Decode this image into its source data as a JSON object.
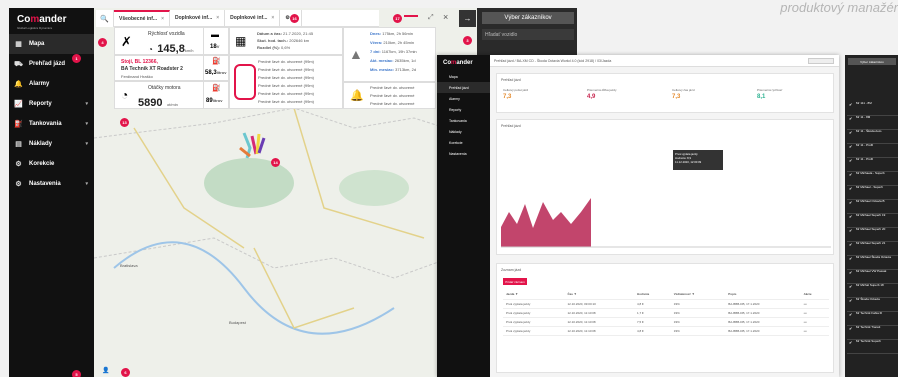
{
  "heading": "produktový manažér",
  "sidebar": {
    "logo_a": "Co",
    "logo_b": "m",
    "logo_c": "ander",
    "logo_sub": "Global Logistics Dynamics",
    "items": [
      {
        "label": "Mapa",
        "icon": "▦"
      },
      {
        "label": "Prehľad jázd",
        "icon": "⛟"
      },
      {
        "label": "Alarmy",
        "icon": "🔔"
      },
      {
        "label": "Reporty",
        "icon": "📈"
      },
      {
        "label": "Tankovania",
        "icon": "⛽"
      },
      {
        "label": "Náklady",
        "icon": "▤"
      },
      {
        "label": "Korekcie",
        "icon": "⚙"
      },
      {
        "label": "Nastavenia",
        "icon": "⚙"
      }
    ]
  },
  "badges": {
    "b1": "1",
    "b3": "3",
    "b4": "4",
    "b5": "5",
    "b6": "6",
    "b12": "12",
    "b13": "13",
    "b14": "14",
    "b16": "16",
    "b17": "17"
  },
  "tabs": [
    {
      "label": "Všeobecné inf..."
    },
    {
      "label": "Doplnkové inf..."
    },
    {
      "label": "Doplnkové inf..."
    }
  ],
  "vehicle": {
    "speed_label": "Rýchlosť vozidla",
    "speed_value": "145,8",
    "speed_unit": "km/h",
    "battery": "18",
    "battery_unit": "V",
    "status": "Stojí, BL 12366,",
    "vehicle_name": "BA Technik XT Roadster 2",
    "driver": "Ferdinand Hraško",
    "fuel": "58,3",
    "fuel_unit": "litrov",
    "rpm_label": "Otáčky motora",
    "rpm_value": "5890",
    "rpm_unit": "ot/min",
    "fuel2": "89",
    "fuel2_unit": "litrov"
  },
  "info": {
    "date_label": "Dátum a čas:",
    "date_value": "21.7.2020, 21:45",
    "tach_label": "Skut. hod. tach.:",
    "tach_value": "202646 km",
    "diff_label": "Rozdiel (%):",
    "diff_value": "0,6%",
    "doors": [
      "Predné ľavé dv. otvorené (99m)",
      "Predné ľavé dv. otvorené (99m)",
      "Predné ľavé dv. otvorené (99m)",
      "Predné ľavé dv. otvorené (99m)",
      "Predné ľavé dv. otvorené (99m)",
      "Predné ľavé dv. otvorené (99m)"
    ],
    "alarm_doors": [
      "Predné ľavé dv. otvorené",
      "Predné ľavé dv. otvorené",
      "Predné ľavé dv. otvorené"
    ]
  },
  "trips": {
    "today_l": "Dnes:",
    "today_v": "175km, 2h 56min",
    "yday_l": "Včera:",
    "yday_v": "210km, 2h 45min",
    "week_l": "7 dní:",
    "week_v": "1167km, 19h 37min",
    "month_l": "Akt. mesiac:",
    "month_v": "2635km, 1d",
    "min_l": "Min. mesiac:",
    "min_v": "3713km, 2d"
  },
  "map_labels": {
    "city1": "Bratislava",
    "city2": "Budapest"
  },
  "customer": {
    "button": "Výber zákazníkov",
    "search": "Hľadať vozidlo"
  },
  "shot2": {
    "breadcrumb": "Prehľad jázd / BA-XM CD - Škoda Octavia Workd 4.0 (kód 2918) / 03/Jazda",
    "side": [
      "Mapa",
      "Prehľad jázd",
      "Alarmy",
      "Reporty",
      "Tankovania",
      "Náklady",
      "Korekcie",
      "Nastavenia"
    ],
    "kpi": [
      {
        "l": "Celkový počet jázd",
        "v": "7,3"
      },
      {
        "l": "Priemerná dĺžka jazdy",
        "v": "4,9"
      },
      {
        "l": "Celkový čas jázd",
        "v": "7,3"
      },
      {
        "l": "Priemerná rýchlosť",
        "v": "8,1"
      }
    ],
    "chart_title": "Prehľad jázd",
    "tooltip": [
      "Prvá výplata jazdy",
      "Hodnota: 8,9",
      "11.12.2020, 12:00:09"
    ],
    "table_title": "Zoznam jázd",
    "table_btn": "Pridať záznam",
    "cols": [
      "Jazda ▼",
      "Čas ▼",
      "Hodnota",
      "Vzdialenosť ▼",
      "Popis",
      "Akcie"
    ],
    "rows": [
      [
        "Prvá výplata jazdy",
        "12.10.2020, 09:00:10",
        "4,8 €",
        "33%",
        "BA-BBB-DB, 17.1.2020"
      ],
      [
        "Prvá výplata jazdy",
        "12.10.2020, 11:10:08",
        "1,7 €",
        "33%",
        "BA-BBB-DB, 17.1.2020"
      ],
      [
        "Prvá výplata jazdy",
        "12.10.2020, 11:10:08",
        "7,5 €",
        "33%",
        "BA-BBB-DB, 17.1.2020"
      ],
      [
        "Prvá výplata jazdy",
        "12.10.2020, 11:10:08",
        "4,8 €",
        "33%",
        "BA-BBB-DB, 17.1.2020"
      ]
    ]
  },
  "shot3": {
    "head": "Výber zákazníkov",
    "items": [
      "Mr 111 - 8M",
      "Mr 11 - 8M",
      "Mr 11 - Škoda Auto",
      "Mr 11 - Profil",
      "Mr 11 - Profil",
      "Mr Michaela - Superb",
      "Mr Michael - Superb",
      "Mr Michael Octavia B",
      "Mr Michael Superb 19",
      "Mr Michael Superb 20",
      "Mr Michael Superb 21",
      "Mr Michael Škoda Octavia",
      "Mr Michael VW Passat",
      "Mr Michal Superb 18",
      "Mr Škoda Octavia",
      "Mr Technik Fabia III",
      "Mr Technik Transit",
      "Mr Technik Superb"
    ]
  }
}
